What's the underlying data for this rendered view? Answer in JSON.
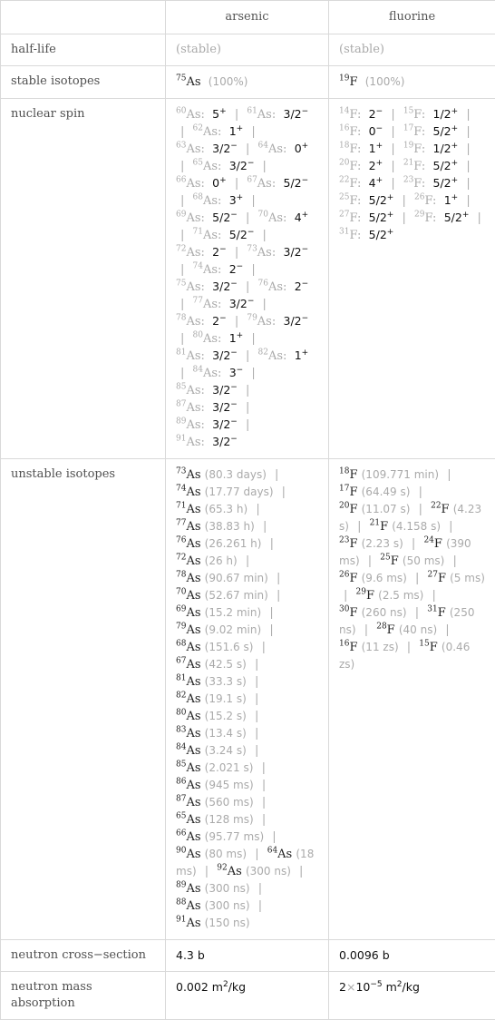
{
  "header": {
    "corner": "",
    "columns": [
      "arsenic",
      "fluorine"
    ]
  },
  "rows": {
    "half_life": {
      "label": "half-life",
      "arsenic": "(stable)",
      "fluorine": "(stable)"
    },
    "stable_isotopes": {
      "label": "stable isotopes",
      "arsenic": {
        "mass": "75",
        "symbol": "As",
        "abundance": "(100%)"
      },
      "fluorine": {
        "mass": "19",
        "symbol": "F",
        "abundance": "(100%)"
      }
    },
    "nuclear_spin": {
      "label": "nuclear spin",
      "arsenic": [
        {
          "mass": "60",
          "symbol": "As",
          "spin": "5",
          "parity": "+"
        },
        {
          "mass": "61",
          "symbol": "As",
          "spin": "3/2",
          "parity": "−"
        },
        {
          "mass": "62",
          "symbol": "As",
          "spin": "1",
          "parity": "+"
        },
        {
          "mass": "63",
          "symbol": "As",
          "spin": "3/2",
          "parity": "−"
        },
        {
          "mass": "64",
          "symbol": "As",
          "spin": "0",
          "parity": "+"
        },
        {
          "mass": "65",
          "symbol": "As",
          "spin": "3/2",
          "parity": "−"
        },
        {
          "mass": "66",
          "symbol": "As",
          "spin": "0",
          "parity": "+"
        },
        {
          "mass": "67",
          "symbol": "As",
          "spin": "5/2",
          "parity": "−"
        },
        {
          "mass": "68",
          "symbol": "As",
          "spin": "3",
          "parity": "+"
        },
        {
          "mass": "69",
          "symbol": "As",
          "spin": "5/2",
          "parity": "−"
        },
        {
          "mass": "70",
          "symbol": "As",
          "spin": "4",
          "parity": "+"
        },
        {
          "mass": "71",
          "symbol": "As",
          "spin": "5/2",
          "parity": "−"
        },
        {
          "mass": "72",
          "symbol": "As",
          "spin": "2",
          "parity": "−"
        },
        {
          "mass": "73",
          "symbol": "As",
          "spin": "3/2",
          "parity": "−"
        },
        {
          "mass": "74",
          "symbol": "As",
          "spin": "2",
          "parity": "−"
        },
        {
          "mass": "75",
          "symbol": "As",
          "spin": "3/2",
          "parity": "−"
        },
        {
          "mass": "76",
          "symbol": "As",
          "spin": "2",
          "parity": "−"
        },
        {
          "mass": "77",
          "symbol": "As",
          "spin": "3/2",
          "parity": "−"
        },
        {
          "mass": "78",
          "symbol": "As",
          "spin": "2",
          "parity": "−"
        },
        {
          "mass": "79",
          "symbol": "As",
          "spin": "3/2",
          "parity": "−"
        },
        {
          "mass": "80",
          "symbol": "As",
          "spin": "1",
          "parity": "+"
        },
        {
          "mass": "81",
          "symbol": "As",
          "spin": "3/2",
          "parity": "−"
        },
        {
          "mass": "82",
          "symbol": "As",
          "spin": "1",
          "parity": "+"
        },
        {
          "mass": "84",
          "symbol": "As",
          "spin": "3",
          "parity": "−"
        },
        {
          "mass": "85",
          "symbol": "As",
          "spin": "3/2",
          "parity": "−"
        },
        {
          "mass": "87",
          "symbol": "As",
          "spin": "3/2",
          "parity": "−"
        },
        {
          "mass": "89",
          "symbol": "As",
          "spin": "3/2",
          "parity": "−"
        },
        {
          "mass": "91",
          "symbol": "As",
          "spin": "3/2",
          "parity": "−"
        }
      ],
      "fluorine": [
        {
          "mass": "14",
          "symbol": "F",
          "spin": "2",
          "parity": "−"
        },
        {
          "mass": "15",
          "symbol": "F",
          "spin": "1/2",
          "parity": "+"
        },
        {
          "mass": "16",
          "symbol": "F",
          "spin": "0",
          "parity": "−"
        },
        {
          "mass": "17",
          "symbol": "F",
          "spin": "5/2",
          "parity": "+"
        },
        {
          "mass": "18",
          "symbol": "F",
          "spin": "1",
          "parity": "+"
        },
        {
          "mass": "19",
          "symbol": "F",
          "spin": "1/2",
          "parity": "+"
        },
        {
          "mass": "20",
          "symbol": "F",
          "spin": "2",
          "parity": "+"
        },
        {
          "mass": "21",
          "symbol": "F",
          "spin": "5/2",
          "parity": "+"
        },
        {
          "mass": "22",
          "symbol": "F",
          "spin": "4",
          "parity": "+"
        },
        {
          "mass": "23",
          "symbol": "F",
          "spin": "5/2",
          "parity": "+"
        },
        {
          "mass": "25",
          "symbol": "F",
          "spin": "5/2",
          "parity": "+"
        },
        {
          "mass": "26",
          "symbol": "F",
          "spin": "1",
          "parity": "+"
        },
        {
          "mass": "27",
          "symbol": "F",
          "spin": "5/2",
          "parity": "+"
        },
        {
          "mass": "29",
          "symbol": "F",
          "spin": "5/2",
          "parity": "+"
        },
        {
          "mass": "31",
          "symbol": "F",
          "spin": "5/2",
          "parity": "+"
        }
      ]
    },
    "unstable_isotopes": {
      "label": "unstable isotopes",
      "arsenic": [
        {
          "mass": "73",
          "symbol": "As",
          "half_life": "(80.3 days)"
        },
        {
          "mass": "74",
          "symbol": "As",
          "half_life": "(17.77 days)"
        },
        {
          "mass": "71",
          "symbol": "As",
          "half_life": "(65.3 h)"
        },
        {
          "mass": "77",
          "symbol": "As",
          "half_life": "(38.83 h)"
        },
        {
          "mass": "76",
          "symbol": "As",
          "half_life": "(26.261 h)"
        },
        {
          "mass": "72",
          "symbol": "As",
          "half_life": "(26 h)"
        },
        {
          "mass": "78",
          "symbol": "As",
          "half_life": "(90.67 min)"
        },
        {
          "mass": "70",
          "symbol": "As",
          "half_life": "(52.67 min)"
        },
        {
          "mass": "69",
          "symbol": "As",
          "half_life": "(15.2 min)"
        },
        {
          "mass": "79",
          "symbol": "As",
          "half_life": "(9.02 min)"
        },
        {
          "mass": "68",
          "symbol": "As",
          "half_life": "(151.6 s)"
        },
        {
          "mass": "67",
          "symbol": "As",
          "half_life": "(42.5 s)"
        },
        {
          "mass": "81",
          "symbol": "As",
          "half_life": "(33.3 s)"
        },
        {
          "mass": "82",
          "symbol": "As",
          "half_life": "(19.1 s)"
        },
        {
          "mass": "80",
          "symbol": "As",
          "half_life": "(15.2 s)"
        },
        {
          "mass": "83",
          "symbol": "As",
          "half_life": "(13.4 s)"
        },
        {
          "mass": "84",
          "symbol": "As",
          "half_life": "(3.24 s)"
        },
        {
          "mass": "85",
          "symbol": "As",
          "half_life": "(2.021 s)"
        },
        {
          "mass": "86",
          "symbol": "As",
          "half_life": "(945 ms)"
        },
        {
          "mass": "87",
          "symbol": "As",
          "half_life": "(560 ms)"
        },
        {
          "mass": "65",
          "symbol": "As",
          "half_life": "(128 ms)"
        },
        {
          "mass": "66",
          "symbol": "As",
          "half_life": "(95.77 ms)"
        },
        {
          "mass": "90",
          "symbol": "As",
          "half_life": "(80 ms)"
        },
        {
          "mass": "64",
          "symbol": "As",
          "half_life": "(18 ms)"
        },
        {
          "mass": "92",
          "symbol": "As",
          "half_life": "(300 ns)"
        },
        {
          "mass": "89",
          "symbol": "As",
          "half_life": "(300 ns)"
        },
        {
          "mass": "88",
          "symbol": "As",
          "half_life": "(300 ns)"
        },
        {
          "mass": "91",
          "symbol": "As",
          "half_life": "(150 ns)"
        }
      ],
      "fluorine": [
        {
          "mass": "18",
          "symbol": "F",
          "half_life": "(109.771 min)"
        },
        {
          "mass": "17",
          "symbol": "F",
          "half_life": "(64.49 s)"
        },
        {
          "mass": "20",
          "symbol": "F",
          "half_life": "(11.07 s)"
        },
        {
          "mass": "22",
          "symbol": "F",
          "half_life": "(4.23 s)"
        },
        {
          "mass": "21",
          "symbol": "F",
          "half_life": "(4.158 s)"
        },
        {
          "mass": "23",
          "symbol": "F",
          "half_life": "(2.23 s)"
        },
        {
          "mass": "24",
          "symbol": "F",
          "half_life": "(390 ms)"
        },
        {
          "mass": "25",
          "symbol": "F",
          "half_life": "(50 ms)"
        },
        {
          "mass": "26",
          "symbol": "F",
          "half_life": "(9.6 ms)"
        },
        {
          "mass": "27",
          "symbol": "F",
          "half_life": "(5 ms)"
        },
        {
          "mass": "29",
          "symbol": "F",
          "half_life": "(2.5 ms)"
        },
        {
          "mass": "30",
          "symbol": "F",
          "half_life": "(260 ns)"
        },
        {
          "mass": "31",
          "symbol": "F",
          "half_life": "(250 ns)"
        },
        {
          "mass": "28",
          "symbol": "F",
          "half_life": "(40 ns)"
        },
        {
          "mass": "16",
          "symbol": "F",
          "half_life": "(11 zs)"
        },
        {
          "mass": "15",
          "symbol": "F",
          "half_life": "(0.46 zs)"
        }
      ]
    },
    "neutron_cross_section": {
      "label": "neutron cross−section",
      "arsenic": "4.3 b",
      "fluorine": "0.0096 b"
    },
    "neutron_mass_absorption": {
      "label": "neutron mass absorption",
      "arsenic": {
        "value": "0.002",
        "unit_base": "m",
        "unit_exp": "2",
        "unit_rest": "/kg"
      },
      "fluorine": {
        "mantissa": "2",
        "times": "×",
        "base": "10",
        "exponent": "−5",
        "unit_base": "m",
        "unit_exp": "2",
        "unit_rest": "/kg"
      }
    }
  },
  "separator": "|",
  "colon": ":"
}
